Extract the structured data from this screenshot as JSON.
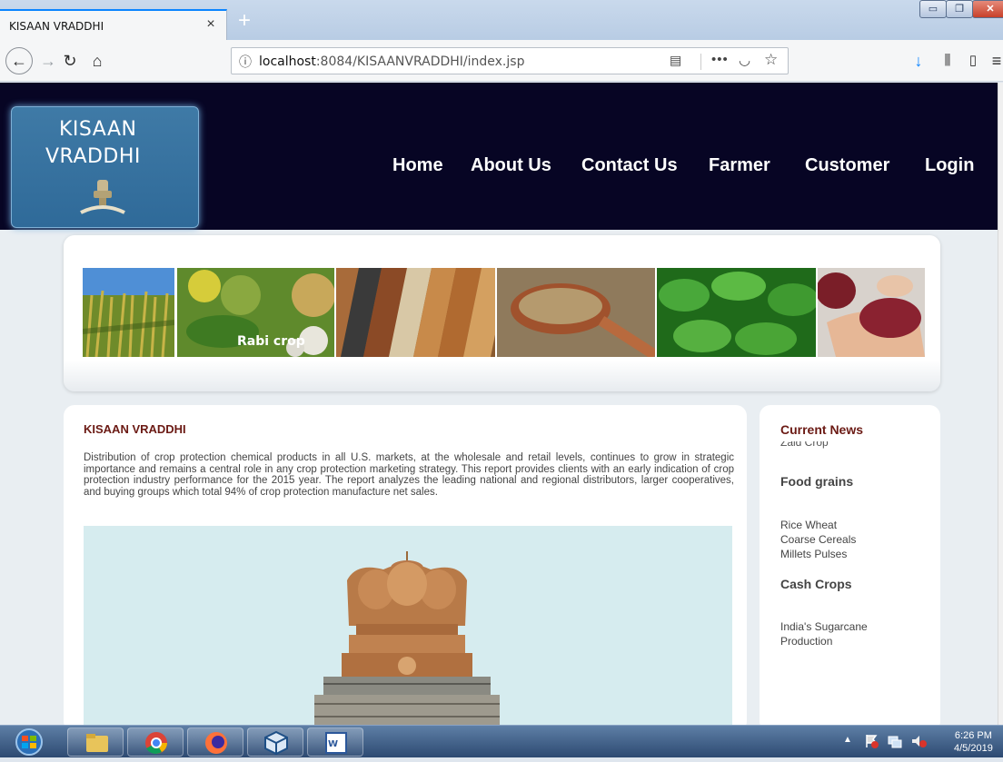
{
  "browser": {
    "tab_title": "KISAAN VRADDHI",
    "tab_close": "×",
    "new_tab": "+",
    "url_host": "localhost",
    "url_rest": ":8084/KISAANVRADDHI/index.jsp",
    "window_buttons": {
      "minimize": "▭",
      "maximize": "❐",
      "close": "✕"
    },
    "icons": [
      "back-icon",
      "forward-icon",
      "reload-icon",
      "home-icon",
      "info-icon",
      "reader-view-icon",
      "more-icon",
      "pocket-icon",
      "bookmark-star-icon",
      "download-icon",
      "library-icon",
      "sidebar-icon",
      "hamburger-menu-icon"
    ]
  },
  "site": {
    "logo_line1": "KISAAN",
    "logo_line2": "VRADDHI",
    "nav": {
      "home": "Home",
      "about": "About Us",
      "contact": "Contact Us",
      "farmer": "Farmer",
      "customer": "Customer",
      "login": "Login"
    },
    "banner_images": [
      "wheat-field",
      "rabi-crop",
      "grain-assortment",
      "seeds-spoon",
      "leafy-crop",
      "seeds-in-hands"
    ],
    "banner_caption": "Rabi crop",
    "main": {
      "heading": "KISAAN VRADDHI",
      "text": "Distribution of crop protection chemical products in all U.S. markets, at the wholesale and retail levels, continues to grow in strategic importance and remains a central role in any crop protection marketing strategy. This report provides clients with an early indication of crop protection industry performance for the 2015 year. The report analyzes the leading national and regional distributors, larger cooperatives, and buying groups which total 94% of crop protection manufacture net sales."
    },
    "news": {
      "heading": "Current News",
      "cut_item": "Zaid Crop",
      "cat1": "Food grains",
      "cat1_item_a": "Rice Wheat",
      "cat1_item_b": "Coarse Cereals",
      "cat1_item_c": "Millets Pulses",
      "cat2": "Cash Crops",
      "cat2_item_a": "India's Sugarcane",
      "cat2_item_b": "Production"
    }
  },
  "taskbar": {
    "time": "6:26 PM",
    "date": "4/5/2019",
    "apps": [
      "start-orb",
      "file-explorer",
      "chrome",
      "firefox",
      "virtualbox",
      "word"
    ]
  },
  "colors": {
    "header_bg": "#070524",
    "logo_bg": "#2f6a99",
    "heading_color": "#6b1a14",
    "page_bg": "#e9eef2",
    "accent_blue": "#0a84ff"
  }
}
